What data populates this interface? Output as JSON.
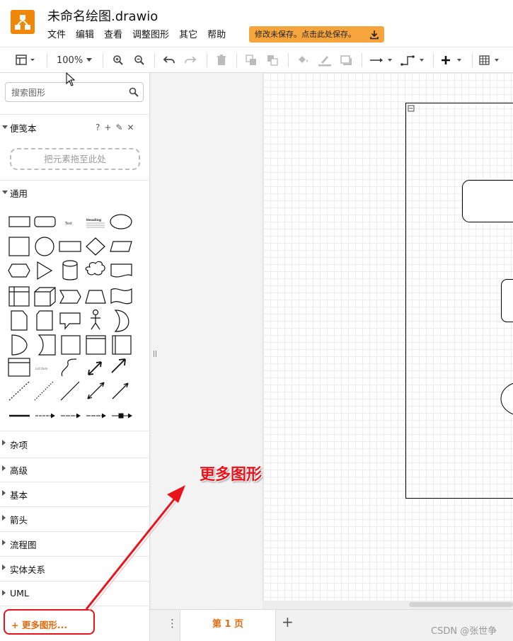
{
  "app": {
    "title": "未命名绘图.drawio",
    "menu": [
      "文件",
      "编辑",
      "查看",
      "调整图形",
      "其它",
      "帮助"
    ],
    "unsaved_notice": "修改未保存。点击此处保存。",
    "brand_color": "#f08705"
  },
  "toolbar": {
    "zoom": "100%",
    "icons": [
      "format-panel-icon",
      "zoom-in-icon",
      "zoom-out-icon",
      "undo-icon",
      "redo-icon",
      "delete-icon",
      "to-front-icon",
      "to-back-icon",
      "fill-color-icon",
      "line-color-icon",
      "shadow-icon",
      "connection-icon",
      "waypoints-icon",
      "insert-icon",
      "table-icon"
    ]
  },
  "sidebar": {
    "search_placeholder": "搜索图形",
    "scratchpad": {
      "title": "便笺本",
      "tools": [
        "?",
        "+",
        "✎",
        "✕"
      ],
      "dropzone": "把元素拖至此处"
    },
    "general": {
      "title": "通用",
      "text_shape": "Text",
      "heading_shape": "Heading",
      "list_item_label": "List Item"
    },
    "collapsed_sections": [
      "杂项",
      "高级",
      "基本",
      "箭头",
      "流程图",
      "实体关系",
      "UML"
    ],
    "more_shapes": "+ 更多图形..."
  },
  "pages": {
    "tabs": [
      "第 1 页"
    ],
    "menu_icon": "⋮",
    "add_icon": "+"
  },
  "annotation": {
    "text": "更多图形",
    "color": "#e8141b"
  },
  "watermark": "CSDN @张世争"
}
